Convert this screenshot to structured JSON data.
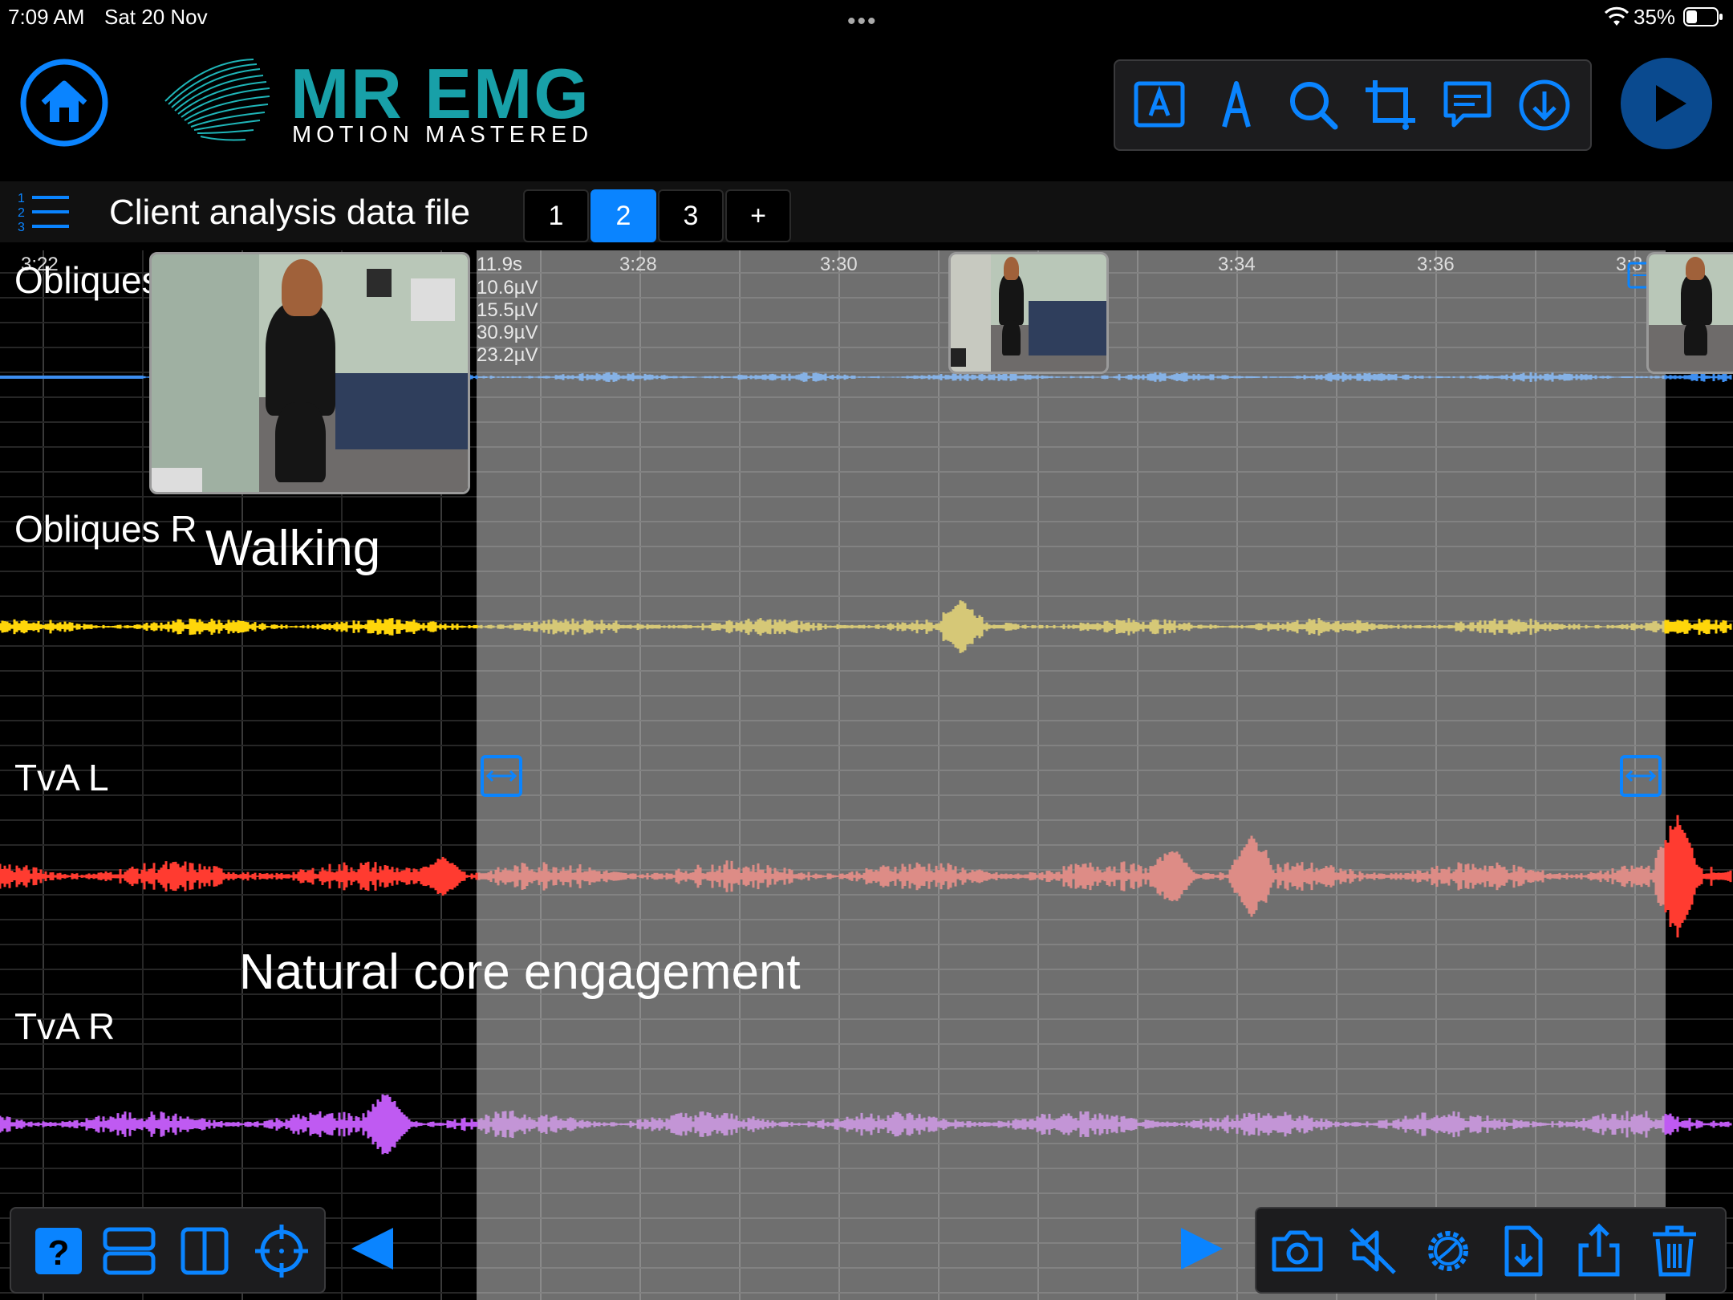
{
  "status_bar": {
    "time": "7:09 AM",
    "date": "Sat 20 Nov",
    "battery": "35%"
  },
  "app": {
    "logo_title": "MR EMG",
    "logo_subtitle": "MOTION MASTERED"
  },
  "file": {
    "title": "Client analysis data file",
    "tabs": [
      "1",
      "2",
      "3",
      "+"
    ],
    "active_tab": "2"
  },
  "header_icons": [
    "home-icon",
    "text-annotation-icon",
    "pen-icon",
    "search-icon",
    "crop-icon",
    "comment-icon",
    "download-icon",
    "play-icon"
  ],
  "timeline": {
    "start_label": "3:22",
    "ticks": [
      "3:28",
      "3:30",
      "3:34",
      "3:36",
      "3:3"
    ],
    "selection_duration": "11.9s",
    "readouts": [
      "10.6µV",
      "15.5µV",
      "30.9µV",
      "23.2µV"
    ]
  },
  "channels": [
    {
      "label": "Obliques L",
      "color": "#3d8ef0"
    },
    {
      "label": "Obliques R",
      "color": "#ffd60a"
    },
    {
      "label": "TvA L",
      "color": "#ff3b30"
    },
    {
      "label": "TvA R",
      "color": "#bf5af2"
    }
  ],
  "annotations": {
    "walking": "Walking",
    "core": "Natural core engagement"
  },
  "accent": "#0a84ff",
  "bottom_left_icons": [
    "help-icon",
    "stacked-view-icon",
    "split-view-icon",
    "target-icon",
    "previous-icon"
  ],
  "bottom_right_icons": [
    "next-icon",
    "camera-icon",
    "mute-icon",
    "settings-icon",
    "import-file-icon",
    "share-icon",
    "trash-icon"
  ]
}
